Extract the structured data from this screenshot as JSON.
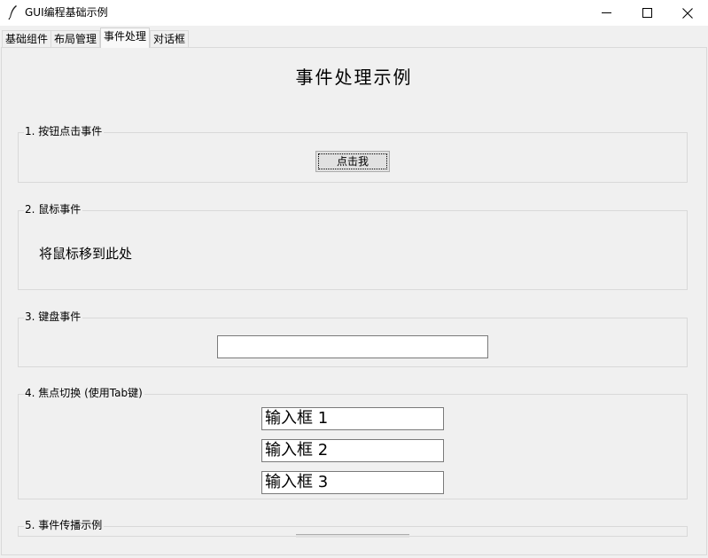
{
  "window": {
    "title": "GUI编程基础示例",
    "icons": {
      "app": "feather-icon",
      "minimize": "minimize-icon",
      "maximize": "maximize-icon",
      "close": "close-icon"
    }
  },
  "tabs": [
    {
      "label": "基础组件",
      "active": false
    },
    {
      "label": "布局管理",
      "active": false
    },
    {
      "label": "事件处理",
      "active": true
    },
    {
      "label": "对话框",
      "active": false
    }
  ],
  "main": {
    "heading": "事件处理示例",
    "sections": {
      "click": {
        "label": "1. 按钮点击事件",
        "button_label": "点击我"
      },
      "mouse": {
        "label": "2. 鼠标事件",
        "area_text": "将鼠标移到此处"
      },
      "keyboard": {
        "label": "3. 键盘事件",
        "input_value": ""
      },
      "focus": {
        "label": "4. 焦点切换 (使用Tab键)",
        "inputs": [
          "输入框 1",
          "输入框 2",
          "输入框 3"
        ]
      },
      "propagation": {
        "label": "5. 事件传播示例"
      }
    }
  }
}
